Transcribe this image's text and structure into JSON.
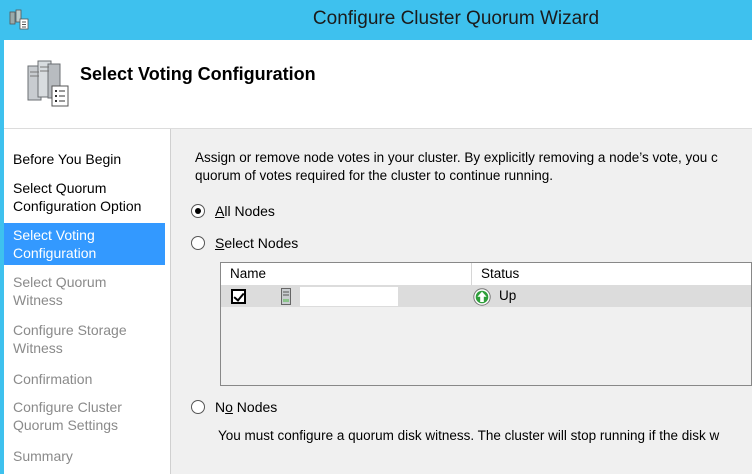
{
  "window": {
    "title": "Configure Cluster Quorum Wizard"
  },
  "page": {
    "title": "Select Voting Configuration"
  },
  "nav": {
    "items": [
      {
        "label": "Before You Begin",
        "state": "normal"
      },
      {
        "label": "Select Quorum Configuration Option",
        "state": "normal"
      },
      {
        "label": "Select Voting Configuration",
        "state": "active"
      },
      {
        "label": "Select Quorum Witness",
        "state": "disabled"
      },
      {
        "label": "Configure Storage Witness",
        "state": "disabled"
      },
      {
        "label": "Confirmation",
        "state": "disabled"
      },
      {
        "label": "Configure Cluster Quorum Settings",
        "state": "disabled"
      },
      {
        "label": "Summary",
        "state": "disabled"
      }
    ]
  },
  "content": {
    "description_line1": "Assign or remove node votes in your cluster. By explicitly removing a node’s vote, you c",
    "description_line2": "quorum of votes required for the cluster to continue running.",
    "options": {
      "all_nodes": {
        "mnemonic": "A",
        "rest": "ll Nodes",
        "selected": true
      },
      "select_nodes": {
        "mnemonic": "S",
        "rest": "elect Nodes",
        "selected": false
      },
      "no_nodes": {
        "prefix": "N",
        "mnemonic": "o",
        "rest": " Nodes",
        "selected": false
      }
    },
    "grid": {
      "columns": {
        "name": "Name",
        "status": "Status"
      },
      "rows": [
        {
          "checked": true,
          "name": "",
          "status": "Up"
        }
      ]
    },
    "no_nodes_note": "You must configure a quorum disk witness. The cluster will stop running if the disk w"
  },
  "colors": {
    "titlebar": "#3ec1ee",
    "nav_active": "#3399ff",
    "status_up": "#2e9e3a"
  }
}
